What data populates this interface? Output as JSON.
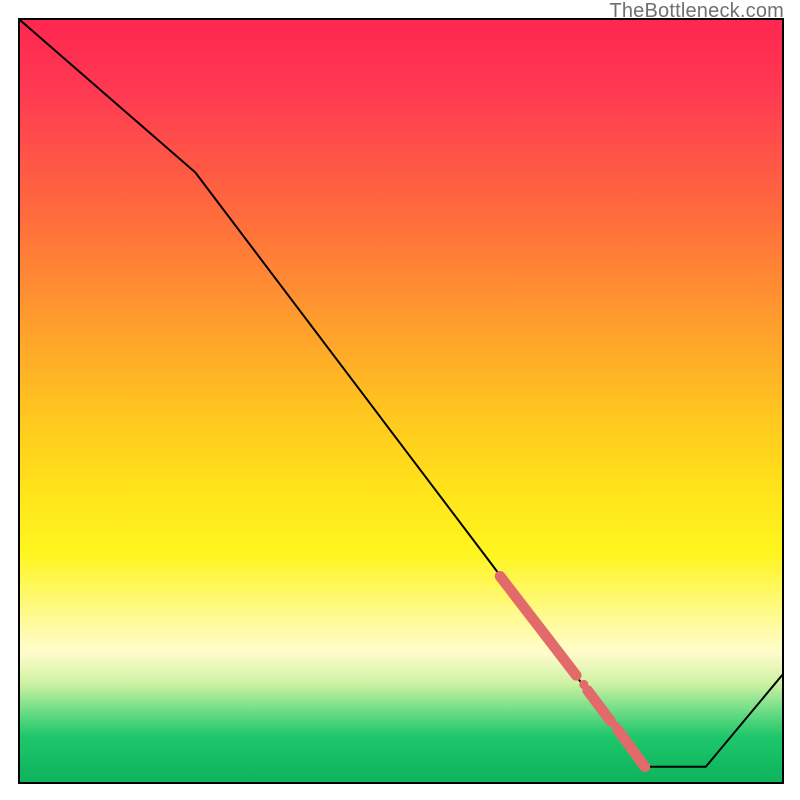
{
  "attribution": "TheBottleneck.com",
  "chart_data": {
    "type": "line",
    "title": "",
    "xlabel": "",
    "ylabel": "",
    "x": [
      0.0,
      0.23,
      0.82,
      0.9,
      1.0
    ],
    "values": [
      1.0,
      0.8,
      0.02,
      0.02,
      0.14
    ],
    "xlim": [
      0,
      1
    ],
    "ylim": [
      0,
      1
    ],
    "series": [
      {
        "name": "bottleneck-curve",
        "x": [
          0.0,
          0.23,
          0.82,
          0.9,
          1.0
        ],
        "y": [
          1.0,
          0.8,
          0.02,
          0.02,
          0.14
        ]
      }
    ],
    "highlight_segments": [
      {
        "name": "thick-band-upper",
        "x0": 0.63,
        "y0": 0.27,
        "x1": 0.73,
        "y1": 0.14,
        "width": 14
      },
      {
        "name": "thick-band-mid",
        "x0": 0.745,
        "y0": 0.12,
        "x1": 0.775,
        "y1": 0.08,
        "width": 14
      },
      {
        "name": "thick-band-lower",
        "x0": 0.785,
        "y0": 0.068,
        "x1": 0.82,
        "y1": 0.02,
        "width": 14
      }
    ],
    "markers": [
      {
        "name": "dot-1",
        "x": 0.74,
        "y": 0.128,
        "r": 6
      },
      {
        "name": "dot-2",
        "x": 0.782,
        "y": 0.073,
        "r": 6
      },
      {
        "name": "dot-3",
        "x": 0.817,
        "y": 0.025,
        "r": 6
      }
    ],
    "colors": {
      "curve": "#000000",
      "highlight": "#e26a6a",
      "gradient_top": "#ff2750",
      "gradient_mid": "#ffe41a",
      "gradient_bottom": "#0fb55d",
      "border": "#000000"
    }
  }
}
